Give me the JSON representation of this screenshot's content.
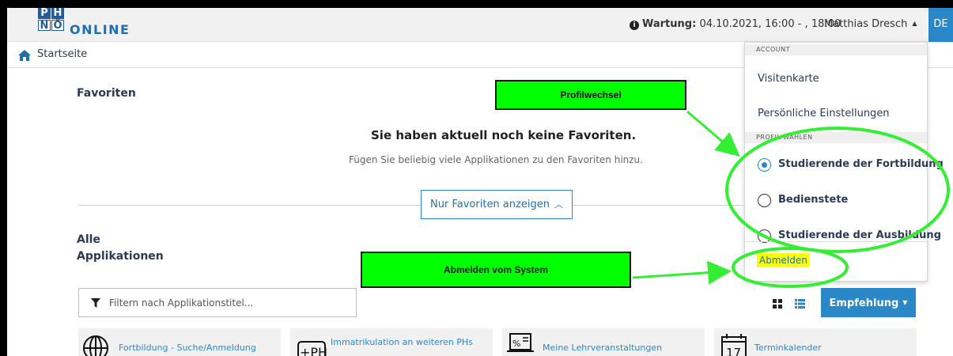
{
  "logo": {
    "letters": [
      "P",
      "H",
      "N",
      "Ö"
    ],
    "text": "ONLINE"
  },
  "header": {
    "maintenance_label": "Wartung:",
    "maintenance_value": "04.10.2021, 16:00 - , 18:00",
    "user_name": "Matthias Dresch",
    "language": "DE"
  },
  "breadcrumb": {
    "home_label": "Startseite"
  },
  "favorites": {
    "title": "Favoriten",
    "empty_title": "Sie haben aktuell noch keine Favoriten.",
    "empty_text": "Fügen Sie beliebig viele Applikationen zu den Favoriten hinzu.",
    "toggle_label": "Nur Favoriten anzeigen"
  },
  "all_apps": {
    "title_line1": "Alle",
    "title_line2": "Applikationen",
    "filter_placeholder": "Filtern nach Applikationstitel...",
    "recommend_label": "Empfehlung",
    "tiles": [
      {
        "label": "Fortbildung - Suche/Anmeldung",
        "icon": "globe-icon"
      },
      {
        "label": "Immatrikulation an weiteren PHs",
        "icon": "ph-icon"
      },
      {
        "label": "Meine Lehrveranstaltungen",
        "icon": "lectures-icon"
      },
      {
        "label": "Terminkalender",
        "icon": "calendar-icon",
        "day": "17"
      }
    ]
  },
  "dropdown": {
    "section_account": "ACCOUNT",
    "visitenkarte": "Visitenkarte",
    "settings": "Persönliche Einstellungen",
    "section_profile": "PROFIL WÄHLEN",
    "profiles": [
      {
        "label": "Studierende der Fortbildung",
        "selected": true
      },
      {
        "label": "Bedienstete",
        "selected": false
      },
      {
        "label": "Studierende der Ausbildung",
        "selected": false
      }
    ],
    "logout": "Abmelden"
  },
  "annotations": {
    "profile_switch": "Profilwechsel",
    "logout_callout": "Abmelden vom System"
  },
  "colors": {
    "accent": "#2a87c8",
    "brand": "#1f5c98",
    "highlight_green": "#00ff00",
    "highlight_yellow": "#ffff00"
  }
}
